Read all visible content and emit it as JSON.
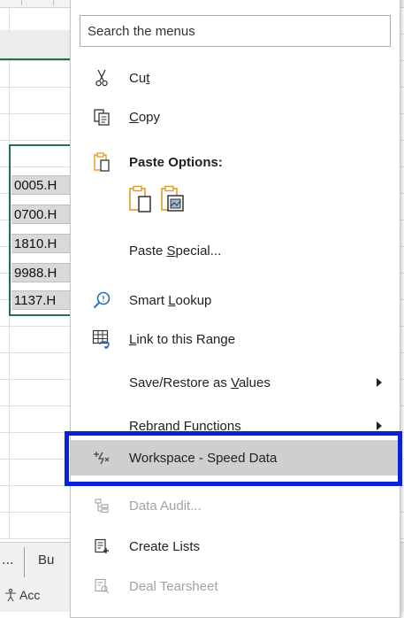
{
  "spreadsheet": {
    "cells": [
      "0005.H",
      "0700.H",
      "1810.H",
      "9988.H",
      "1137.H"
    ],
    "sheet_tab_overflow": "...",
    "sheet_tab_partial": "Bu",
    "status_partial": "Acc"
  },
  "context_menu": {
    "search_placeholder": "Search the menus",
    "cut": {
      "before": "Cu",
      "key": "t",
      "after": ""
    },
    "copy": {
      "before": "",
      "key": "C",
      "after": "opy"
    },
    "paste_options_label": "Paste Options:",
    "paste_special": {
      "before": "Paste ",
      "key": "S",
      "after": "pecial..."
    },
    "smart_lookup": {
      "before": "Smart ",
      "key": "L",
      "after": "ookup"
    },
    "link_to_range": {
      "before": "",
      "key": "L",
      "after": "ink to this Range"
    },
    "save_restore": {
      "before": "Save/Restore as ",
      "key": "V",
      "after": "alues"
    },
    "rebrand_functions": {
      "before": "Rebrand F",
      "key": "u",
      "after": "nctions"
    },
    "workspace_speed_data": "Workspace - Speed Data",
    "data_audit": "Data Audit...",
    "create_lists": "Create Lists",
    "deal_tearsheet": "Deal Tearsheet"
  },
  "colors": {
    "highlight_frame": "#0a22d6",
    "selection_green": "#217346",
    "paste_icon_orange": "#e39a1c"
  }
}
